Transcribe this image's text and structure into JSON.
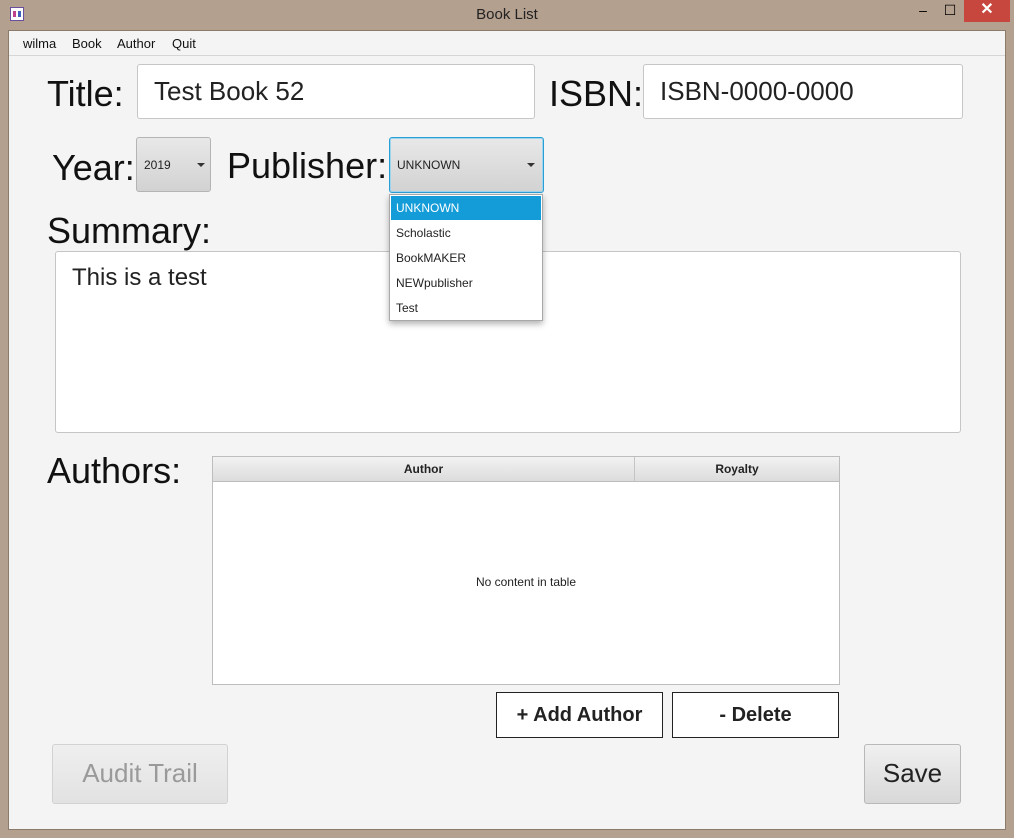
{
  "window": {
    "title": "Book List",
    "minimize": "–",
    "maximize": "☐",
    "close": "✕"
  },
  "menu": {
    "items": [
      "wilma",
      "Book",
      "Author",
      "Quit"
    ]
  },
  "form": {
    "title_label": "Title:",
    "title_value": "Test Book 52",
    "isbn_label": "ISBN:",
    "isbn_value": "ISBN-0000-0000",
    "year_label": "Year:",
    "year_value": "2019",
    "publisher_label": "Publisher:",
    "publisher_value": "UNKNOWN",
    "publisher_options": [
      "UNKNOWN",
      "Scholastic",
      "BookMAKER",
      "NEWpublisher",
      "Test"
    ],
    "summary_label": "Summary:",
    "summary_value": "This is a test",
    "authors_label": "Authors:"
  },
  "authors_table": {
    "columns": [
      "Author",
      "Royalty"
    ],
    "empty_text": "No content in table"
  },
  "buttons": {
    "add_author": "+ Add Author",
    "delete": "- Delete",
    "audit_trail": "Audit Trail",
    "save": "Save"
  },
  "colors": {
    "selection": "#139cd8",
    "focus_border": "#2a9fd6",
    "titlebar": "#b4a08f",
    "close": "#c7463d"
  }
}
